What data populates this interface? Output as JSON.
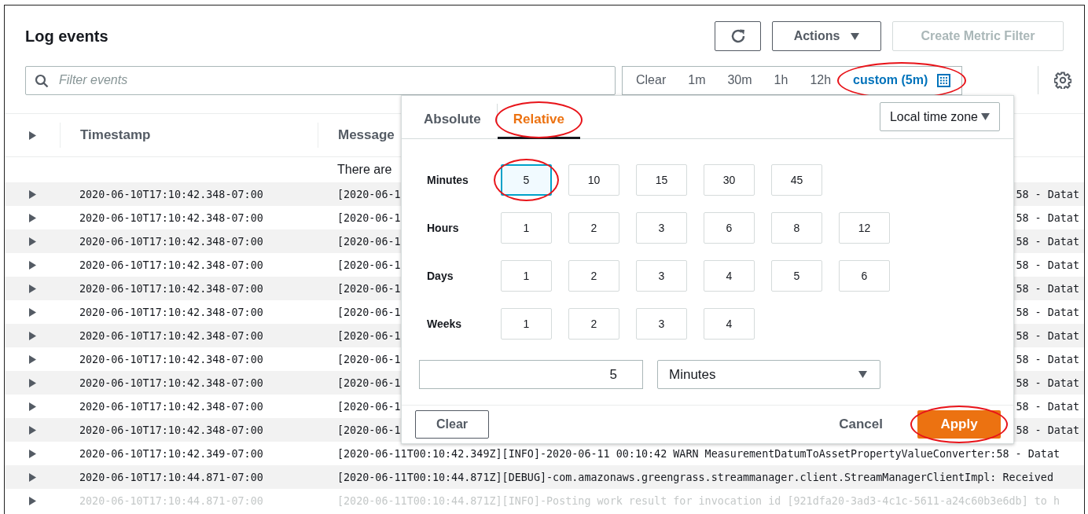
{
  "header": {
    "title": "Log events",
    "actions": "Actions",
    "create_metric_filter": {
      "label": "Create Metric Filter",
      "disabled": true
    }
  },
  "filter": {
    "placeholder": "Filter events"
  },
  "time_range": [
    {
      "label": "Clear",
      "selected": false,
      "circled": false
    },
    {
      "label": "1m",
      "selected": false,
      "circled": false
    },
    {
      "label": "30m",
      "selected": false,
      "circled": false
    },
    {
      "label": "1h",
      "selected": false,
      "circled": false
    },
    {
      "label": "12h",
      "selected": false,
      "circled": false
    },
    {
      "label": "custom (5m)",
      "selected": true,
      "circled": true
    }
  ],
  "popover": {
    "tabs": [
      {
        "label": "Absolute",
        "selected": false,
        "circled": false
      },
      {
        "label": "Relative",
        "selected": true,
        "circled": true
      }
    ],
    "timezone": "Local time zone",
    "groups": [
      {
        "label": "Minutes",
        "options": [
          {
            "label": "5",
            "selected": true,
            "circled": true
          },
          {
            "label": "10",
            "selected": false,
            "circled": false
          },
          {
            "label": "15",
            "selected": false,
            "circled": false
          },
          {
            "label": "30",
            "selected": false,
            "circled": false
          },
          {
            "label": "45",
            "selected": false,
            "circled": false
          }
        ]
      },
      {
        "label": "Hours",
        "options": [
          {
            "label": "1",
            "selected": false,
            "circled": false
          },
          {
            "label": "2",
            "selected": false,
            "circled": false
          },
          {
            "label": "3",
            "selected": false,
            "circled": false
          },
          {
            "label": "6",
            "selected": false,
            "circled": false
          },
          {
            "label": "8",
            "selected": false,
            "circled": false
          },
          {
            "label": "12",
            "selected": false,
            "circled": false
          }
        ]
      },
      {
        "label": "Days",
        "options": [
          {
            "label": "1",
            "selected": false,
            "circled": false
          },
          {
            "label": "2",
            "selected": false,
            "circled": false
          },
          {
            "label": "3",
            "selected": false,
            "circled": false
          },
          {
            "label": "4",
            "selected": false,
            "circled": false
          },
          {
            "label": "5",
            "selected": false,
            "circled": false
          },
          {
            "label": "6",
            "selected": false,
            "circled": false
          }
        ]
      },
      {
        "label": "Weeks",
        "options": [
          {
            "label": "1",
            "selected": false,
            "circled": false
          },
          {
            "label": "2",
            "selected": false,
            "circled": false
          },
          {
            "label": "3",
            "selected": false,
            "circled": false
          },
          {
            "label": "4",
            "selected": false,
            "circled": false
          }
        ]
      }
    ],
    "amount": "5",
    "unit": "Minutes",
    "clear": "Clear",
    "cancel": "Cancel",
    "apply": {
      "label": "Apply",
      "circled": true
    }
  },
  "table": {
    "columns": [
      "Timestamp",
      "Message"
    ],
    "notice": "There are",
    "rows": [
      {
        "timestamp": "2020-06-10T17:10:42.348-07:00",
        "message_start": "[2020-06-1",
        "message_end": "58 - Datat",
        "faded": false
      },
      {
        "timestamp": "2020-06-10T17:10:42.348-07:00",
        "message_start": "[2020-06-1",
        "message_end": "58 - Datat",
        "faded": false
      },
      {
        "timestamp": "2020-06-10T17:10:42.348-07:00",
        "message_start": "[2020-06-1",
        "message_end": "58 - Datat",
        "faded": false
      },
      {
        "timestamp": "2020-06-10T17:10:42.348-07:00",
        "message_start": "[2020-06-1",
        "message_end": "58 - Datat",
        "faded": false
      },
      {
        "timestamp": "2020-06-10T17:10:42.348-07:00",
        "message_start": "[2020-06-1",
        "message_end": "58 - Datat",
        "faded": false
      },
      {
        "timestamp": "2020-06-10T17:10:42.348-07:00",
        "message_start": "[2020-06-1",
        "message_end": "58 - Datat",
        "faded": false
      },
      {
        "timestamp": "2020-06-10T17:10:42.348-07:00",
        "message_start": "[2020-06-1",
        "message_end": "58 - Datat",
        "faded": false
      },
      {
        "timestamp": "2020-06-10T17:10:42.348-07:00",
        "message_start": "[2020-06-1",
        "message_end": "58 - Datat",
        "faded": false
      },
      {
        "timestamp": "2020-06-10T17:10:42.348-07:00",
        "message_start": "[2020-06-1",
        "message_end": "58 - Datat",
        "faded": false
      },
      {
        "timestamp": "2020-06-10T17:10:42.348-07:00",
        "message_start": "[2020-06-1",
        "message_end": "58 - Datat",
        "faded": false
      },
      {
        "timestamp": "2020-06-10T17:10:42.348-07:00",
        "message_start": "[2020-06-1",
        "message_end": "58 - Datat",
        "faded": false
      },
      {
        "timestamp": "2020-06-10T17:10:42.349-07:00",
        "message_start": "[2020-06-11T00:10:42.349Z][INFO]-2020-06-11 00:10:42 WARN MeasurementDatumToAssetPropertyValueConverter:58 - Datat",
        "faded": false
      },
      {
        "timestamp": "2020-06-10T17:10:44.871-07:00",
        "message_start": "[2020-06-11T00:10:44.871Z][DEBUG]-com.amazonaws.greengrass.streammanager.client.StreamManagerClientImpl: Received",
        "faded": false
      },
      {
        "timestamp": "2020-06-10T17:10:44.871-07:00",
        "message_start": "[2020-06-11T00:10:44.871Z][INFO]-Posting work result for invocation id [921dfa20-3ad3-4c1c-5611-a24c60b3e6db] to h",
        "faded": true
      }
    ]
  }
}
